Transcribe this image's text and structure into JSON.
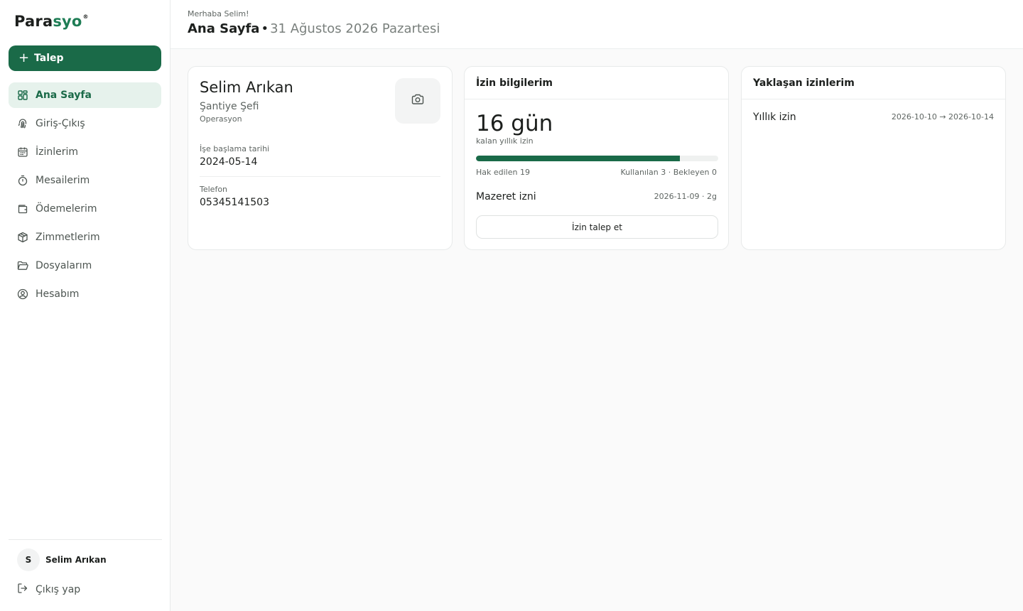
{
  "brand": {
    "part1": "Para",
    "part2": "syo",
    "reg": "®",
    "accent": "#1a6a48"
  },
  "sidebar": {
    "cta_label": "Talep",
    "items": [
      {
        "label": "Ana Sayfa",
        "icon": "dashboard-icon",
        "active": true
      },
      {
        "label": "Giriş-Çıkış",
        "icon": "fingerprint-icon"
      },
      {
        "label": "İzinlerim",
        "icon": "calendar-icon"
      },
      {
        "label": "Mesailerim",
        "icon": "timer-icon"
      },
      {
        "label": "Ödemelerim",
        "icon": "wallet-icon"
      },
      {
        "label": "Zimmetlerim",
        "icon": "package-icon"
      },
      {
        "label": "Dosyalarım",
        "icon": "folder-icon"
      },
      {
        "label": "Hesabım",
        "icon": "user-circle-icon"
      }
    ],
    "user": {
      "initial": "S",
      "name": "Selim Arıkan"
    },
    "logout_label": "Çıkış yap"
  },
  "header": {
    "greeting": "Merhaba Selim!",
    "title": "Ana Sayfa",
    "separator": "•",
    "date": "31 Ağustos 2026 Pazartesi"
  },
  "profile": {
    "name": "Selim Arıkan",
    "role": "Şantiye Şefi",
    "department": "Operasyon",
    "start_label": "İşe başlama tarihi",
    "start_value": "2024-05-14",
    "phone_label": "Telefon",
    "phone_value": "05345141503",
    "photo_icon": "camera-icon"
  },
  "leave": {
    "title": "İzin bilgilerim",
    "remaining": "16 gün",
    "remaining_label": "kalan yıllık izin",
    "progress_fraction": 0.842,
    "earned": "Hak edilen 19",
    "used": "Kullanılan 3 · Bekleyen 0",
    "excuse_label": "Mazeret izni",
    "excuse_info": "2026-11-09 · 2g",
    "request_button": "İzin talep et"
  },
  "upcoming": {
    "title": "Yaklaşan izinlerim",
    "items": [
      {
        "type": "Yıllık izin",
        "range": "2026-10-10 → 2026-10-14"
      }
    ]
  }
}
